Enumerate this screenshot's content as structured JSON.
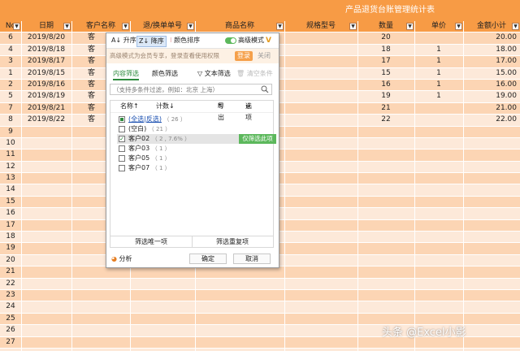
{
  "title": "产品退货台账管理统计表",
  "headers": [
    "No",
    "日期",
    "客户名称",
    "退/换单单号",
    "商品名称",
    "规格型号",
    "数量",
    "单价",
    "金额小计"
  ],
  "rows": [
    {
      "no": "6",
      "date": "2019/8/20",
      "cust": "客",
      "qty": "20",
      "price": "",
      "amt": "20.00"
    },
    {
      "no": "4",
      "date": "2019/8/18",
      "cust": "客",
      "qty": "18",
      "price": "1",
      "amt": "18.00"
    },
    {
      "no": "3",
      "date": "2019/8/17",
      "cust": "客",
      "qty": "17",
      "price": "1",
      "amt": "17.00"
    },
    {
      "no": "1",
      "date": "2019/8/15",
      "cust": "客",
      "qty": "15",
      "price": "1",
      "amt": "15.00"
    },
    {
      "no": "2",
      "date": "2019/8/16",
      "cust": "客",
      "qty": "16",
      "price": "1",
      "amt": "16.00"
    },
    {
      "no": "5",
      "date": "2019/8/19",
      "cust": "客",
      "qty": "19",
      "price": "1",
      "amt": "19.00"
    },
    {
      "no": "7",
      "date": "2019/8/21",
      "cust": "客",
      "qty": "21",
      "price": "",
      "amt": "21.00"
    },
    {
      "no": "8",
      "date": "2019/8/22",
      "cust": "客",
      "qty": "22",
      "price": "",
      "amt": "22.00"
    },
    {
      "no": "9"
    },
    {
      "no": "10"
    },
    {
      "no": "11"
    },
    {
      "no": "12"
    },
    {
      "no": "13"
    },
    {
      "no": "14"
    },
    {
      "no": "15"
    },
    {
      "no": "16"
    },
    {
      "no": "17"
    },
    {
      "no": "18"
    },
    {
      "no": "19"
    },
    {
      "no": "20"
    },
    {
      "no": "21"
    },
    {
      "no": "22"
    },
    {
      "no": "23"
    },
    {
      "no": "24"
    },
    {
      "no": "25"
    },
    {
      "no": "26"
    },
    {
      "no": "27"
    }
  ],
  "filter": {
    "sort_asc": "升序",
    "sort_desc": "降序",
    "sort_color": "颜色排序",
    "advanced_mode": "高级模式",
    "vip_mark": "V",
    "banner_msg": "高级模式为会员专享，登录查看使用权限",
    "login": "登录",
    "close": "关闭",
    "tab_content": "内容筛选",
    "tab_color": "颜色筛选",
    "text_filter": "文本筛选",
    "clear": "清空条件",
    "search_placeholder": "（支持多条件过滤，例如：北京 上海）",
    "col_name": "名称↑",
    "col_count": "计数↓",
    "export": "导出",
    "options": "选项",
    "items": [
      {
        "label": "(全选|反选)",
        "count": "（ 26 ）"
      },
      {
        "label": "(空白)",
        "count": "（ 21 ）"
      },
      {
        "label": "客户02",
        "count": "（ 2 , 7.6% ）"
      },
      {
        "label": "客户03",
        "count": "（ 1 ）"
      },
      {
        "label": "客户05",
        "count": "（ 1 ）"
      },
      {
        "label": "客户07",
        "count": "（ 1 ）"
      }
    ],
    "only_this": "仅筛选此项",
    "filter_unique": "筛选唯一项",
    "filter_dup": "筛选重复项",
    "analyze": "分析",
    "ok": "确定",
    "cancel": "取消"
  },
  "watermark": "头条 @Excel小影",
  "colors": {
    "header": "#f79b45",
    "row_odd": "#fcd5b4",
    "row_even": "#fde9d9",
    "accent": "#5cb85c"
  }
}
